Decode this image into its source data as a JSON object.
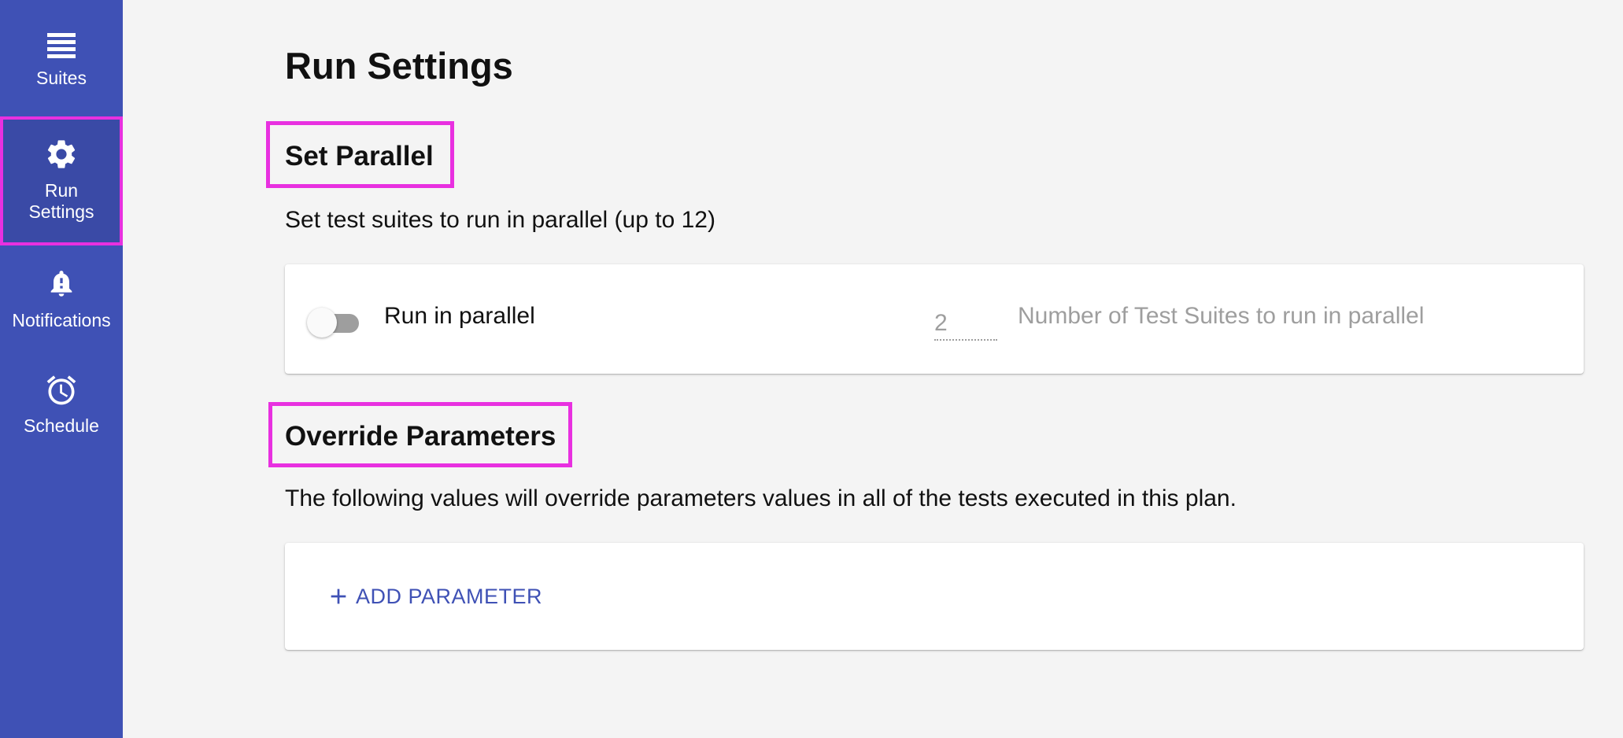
{
  "sidebar": {
    "items": [
      {
        "label": "Suites",
        "icon": "suites-icon",
        "active": false
      },
      {
        "label": "Run Settings",
        "icon": "gear-icon",
        "active": true
      },
      {
        "label": "Notifications",
        "icon": "bell-icon",
        "active": false
      },
      {
        "label": "Schedule",
        "icon": "alarm-clock-icon",
        "active": false
      }
    ]
  },
  "page": {
    "title": "Run Settings"
  },
  "parallel": {
    "heading": "Set Parallel",
    "description": "Set test suites to run in parallel (up to 12)",
    "toggle_label": "Run in parallel",
    "toggle_on": false,
    "count_value": "2",
    "count_helper": "Number of Test Suites to run in parallel"
  },
  "override": {
    "heading": "Override Parameters",
    "description": "The following values will override parameters values in all of the tests executed in this plan.",
    "add_button_label": "ADD PARAMETER"
  },
  "colors": {
    "sidebar_bg": "#3f51b5",
    "highlight": "#e830e0",
    "accent": "#3f51b5",
    "page_bg": "#f4f4f4"
  }
}
